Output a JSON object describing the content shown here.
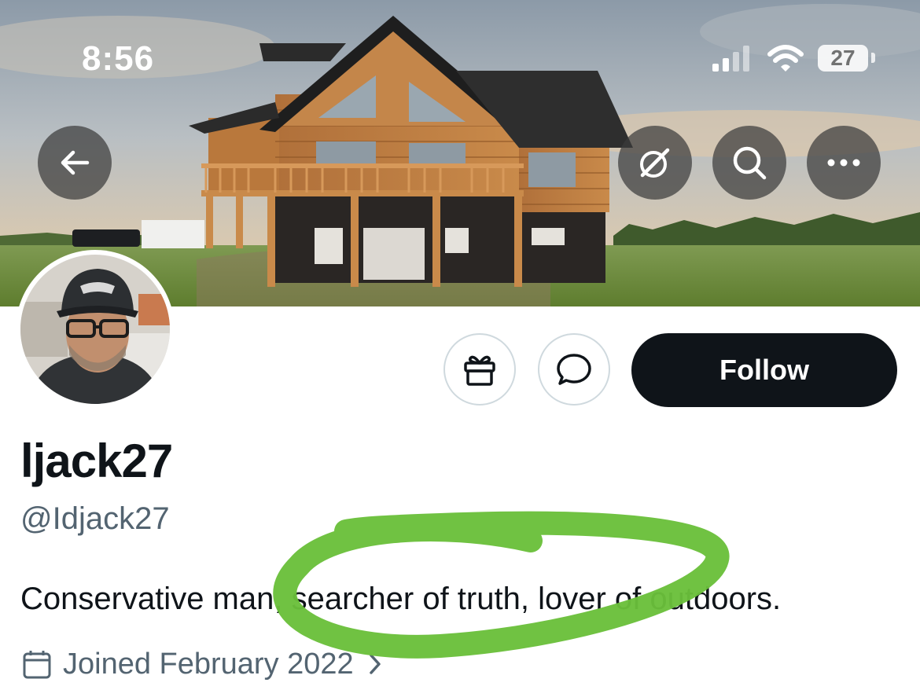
{
  "status_bar": {
    "time": "8:56",
    "battery": "27"
  },
  "banner": {
    "back_icon": "arrow-left-icon",
    "grok_icon": "slash-circle-icon",
    "search_icon": "search-icon",
    "more_icon": "more-horizontal-icon"
  },
  "actions": {
    "gift_icon": "gift-icon",
    "message_icon": "message-bubble-icon",
    "follow_label": "Follow"
  },
  "profile": {
    "display_name": "ljack27",
    "handle": "@Idjack27",
    "bio": "Conservative man, searcher of truth, lover of outdoors.",
    "joined": "Joined February 2022"
  },
  "colors": {
    "primary_text": "#0f1419",
    "secondary_text": "#536471",
    "highlight": "#6abf3a",
    "button_dark": "#0f1419"
  }
}
